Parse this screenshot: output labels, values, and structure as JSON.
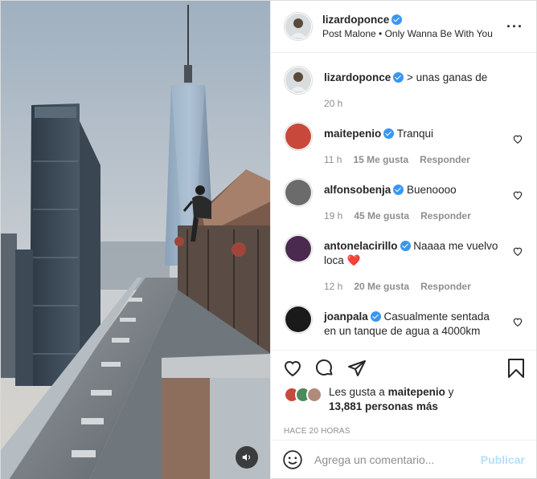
{
  "header": {
    "username": "lizardoponce",
    "song": "Post Malone • Only Wanna Be With You",
    "more_icon": "more-horizontal-icon"
  },
  "caption": {
    "username": "lizardoponce",
    "text": "> unas ganas de",
    "time": "20 h"
  },
  "comments": [
    {
      "username": "maitepenio",
      "text": "Tranqui",
      "time": "11 h",
      "likes": "15 Me gusta",
      "reply": "Responder",
      "avatar_color": "#c9483c"
    },
    {
      "username": "alfonsobenja",
      "text": "Buenoooo",
      "time": "19 h",
      "likes": "45 Me gusta",
      "reply": "Responder",
      "avatar_color": "#6b6b6b"
    },
    {
      "username": "antonelacirillo",
      "text": "Naaaa me vuelvo loca ❤️",
      "time": "12 h",
      "likes": "20 Me gusta",
      "reply": "Responder",
      "avatar_color": "#4a2a4f"
    },
    {
      "username": "joanpala",
      "text": "Casualmente sentada en un tanque de agua a 4000km",
      "time": "",
      "likes": "",
      "reply": "",
      "avatar_color": "#1a1a1a"
    }
  ],
  "likes": {
    "prefix": "Les gusta a",
    "user": "maitepenio",
    "connector": "y",
    "others": "13,881 personas más",
    "avatar_colors": [
      "#c9483c",
      "#4a8a5c",
      "#b08a7a"
    ]
  },
  "timestamp": "HACE 20 HORAS",
  "add_comment": {
    "placeholder": "Agrega un comentario...",
    "post_label": "Publicar",
    "post_color": "#b2dffc"
  },
  "icons": {
    "like": "heart-icon",
    "comment": "comment-icon",
    "share": "share-icon",
    "save": "bookmark-icon",
    "emoji": "emoji-icon",
    "audio": "speaker-icon"
  }
}
